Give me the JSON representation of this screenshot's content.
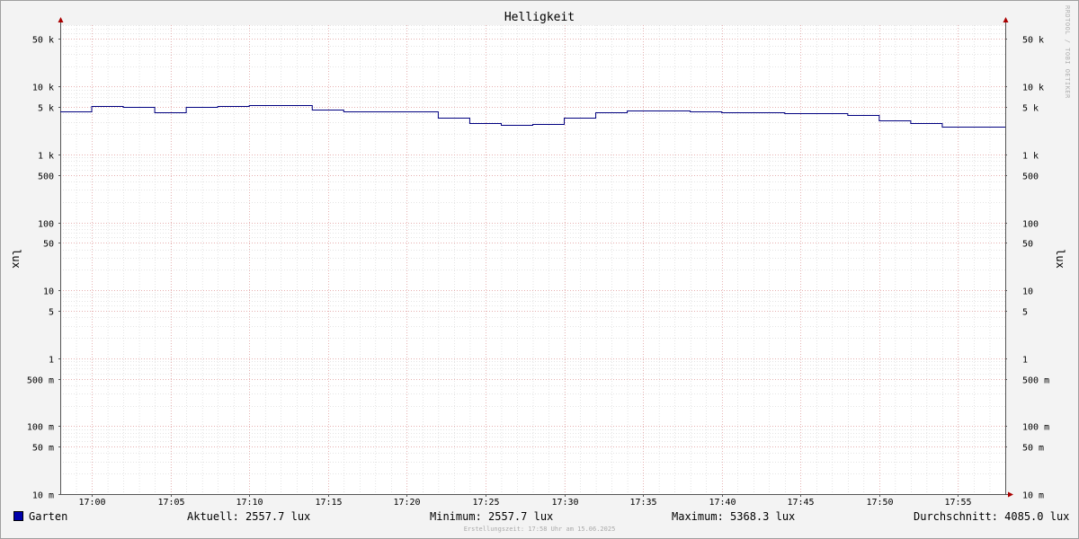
{
  "chart_data": {
    "type": "line",
    "title": "Helligkeit",
    "ylabel_left": "lux",
    "ylabel_right": "lux",
    "yscale": "log",
    "ylim": [
      0.01,
      80000
    ],
    "y_ticks": [
      {
        "v": 0.01,
        "label": "10 m"
      },
      {
        "v": 0.05,
        "label": "50 m"
      },
      {
        "v": 0.1,
        "label": "100 m"
      },
      {
        "v": 0.5,
        "label": "500 m"
      },
      {
        "v": 1,
        "label": "1"
      },
      {
        "v": 5,
        "label": "5"
      },
      {
        "v": 10,
        "label": "10"
      },
      {
        "v": 50,
        "label": "50"
      },
      {
        "v": 100,
        "label": "100"
      },
      {
        "v": 500,
        "label": "500"
      },
      {
        "v": 1000,
        "label": "1 k"
      },
      {
        "v": 5000,
        "label": "5 k"
      },
      {
        "v": 10000,
        "label": "10 k"
      },
      {
        "v": 50000,
        "label": "50 k"
      }
    ],
    "xlim": [
      "16:58",
      "17:58"
    ],
    "x_ticks": [
      "17:00",
      "17:05",
      "17:10",
      "17:15",
      "17:20",
      "17:25",
      "17:30",
      "17:35",
      "17:40",
      "17:45",
      "17:50",
      "17:55"
    ],
    "grid": true,
    "series": [
      {
        "name": "Garten",
        "color": "#000080",
        "points": [
          {
            "x": "16:58",
            "y": 4300
          },
          {
            "x": "17:00",
            "y": 5200
          },
          {
            "x": "17:02",
            "y": 5000
          },
          {
            "x": "17:04",
            "y": 4200
          },
          {
            "x": "17:06",
            "y": 5000
          },
          {
            "x": "17:08",
            "y": 5200
          },
          {
            "x": "17:10",
            "y": 5368.3
          },
          {
            "x": "17:14",
            "y": 4600
          },
          {
            "x": "17:16",
            "y": 4300
          },
          {
            "x": "17:22",
            "y": 3500
          },
          {
            "x": "17:24",
            "y": 2900
          },
          {
            "x": "17:26",
            "y": 2700
          },
          {
            "x": "17:28",
            "y": 2800
          },
          {
            "x": "17:30",
            "y": 3500
          },
          {
            "x": "17:32",
            "y": 4200
          },
          {
            "x": "17:34",
            "y": 4400
          },
          {
            "x": "17:38",
            "y": 4300
          },
          {
            "x": "17:40",
            "y": 4200
          },
          {
            "x": "17:44",
            "y": 4100
          },
          {
            "x": "17:48",
            "y": 3800
          },
          {
            "x": "17:50",
            "y": 3200
          },
          {
            "x": "17:52",
            "y": 2900
          },
          {
            "x": "17:54",
            "y": 2600
          },
          {
            "x": "17:56",
            "y": 2557.7
          },
          {
            "x": "17:58",
            "y": 2557.7
          }
        ]
      }
    ]
  },
  "legend": {
    "series_name": "Garten",
    "current": "Aktuell: 2557.7 lux",
    "minimum": "Minimum: 2557.7 lux",
    "maximum": "Maximum: 5368.3 lux",
    "average": "Durchschnitt: 4085.0 lux"
  },
  "footer": {
    "created": "Erstellungszeit: 17:58 Uhr am 15.06.2025"
  },
  "watermark": "RRDTOOL / TOBI OETIKER",
  "colors": {
    "series": "#000080",
    "swatch": "#0000aa",
    "major_grid": "#e8a0a0",
    "minor_grid": "#c8c8c8",
    "axis": "#555555",
    "arrow": "#aa0000"
  }
}
